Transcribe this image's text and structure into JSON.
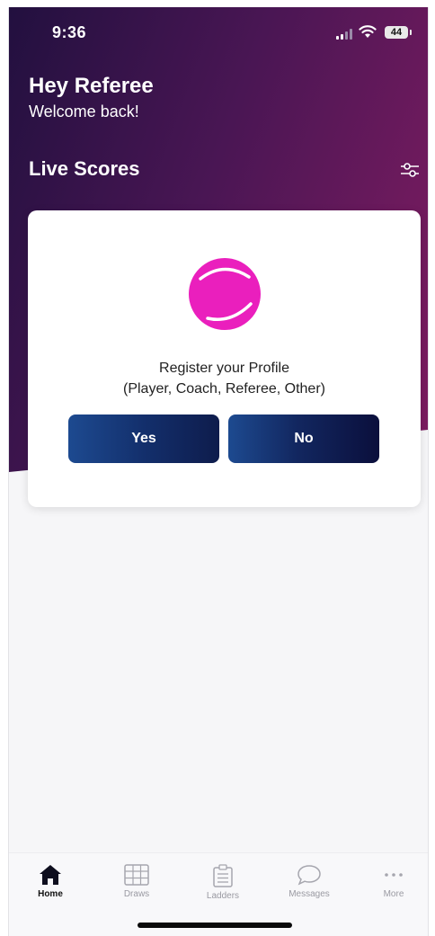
{
  "status_bar": {
    "time": "9:36",
    "battery": "44"
  },
  "header": {
    "greeting": "Hey Referee",
    "welcome": "Welcome back!",
    "section_title": "Live Scores"
  },
  "card": {
    "title": "Register your Profile",
    "subtitle": "(Player, Coach, Referee, Other)",
    "yes_label": "Yes",
    "no_label": "No"
  },
  "tabs": [
    {
      "label": "Home",
      "icon": "home-icon",
      "active": true
    },
    {
      "label": "Draws",
      "icon": "draws-icon",
      "active": false
    },
    {
      "label": "Ladders",
      "icon": "ladders-icon",
      "active": false
    },
    {
      "label": "Messages",
      "icon": "messages-icon",
      "active": false
    },
    {
      "label": "More",
      "icon": "more-icon",
      "active": false
    }
  ],
  "colors": {
    "hero_start": "#22103f",
    "hero_end": "#7d1c60",
    "ball": "#ea1fbd",
    "button": "#132f6c"
  }
}
